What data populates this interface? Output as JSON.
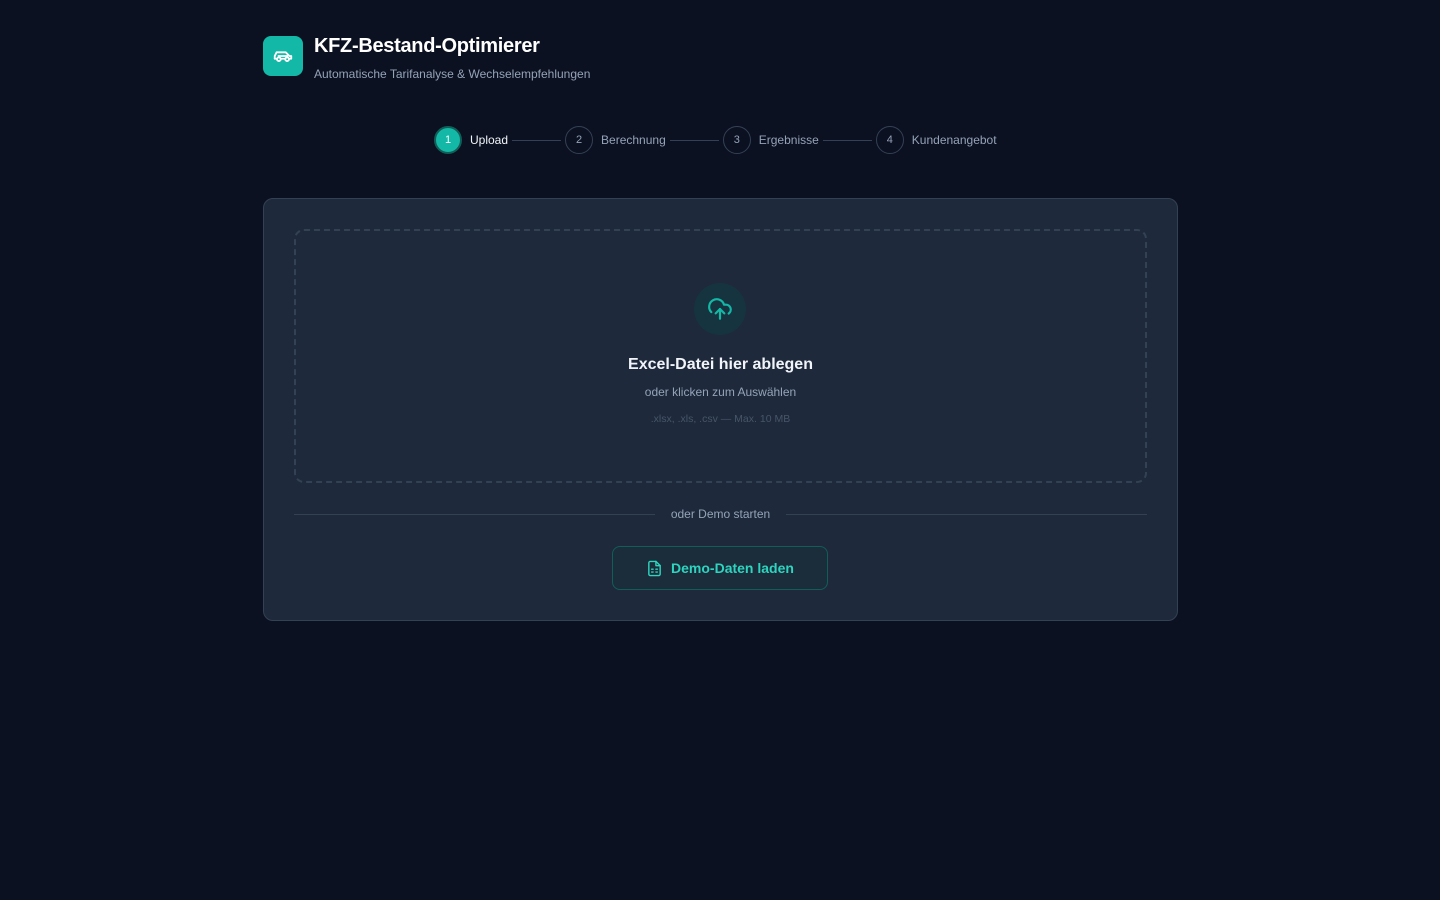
{
  "app": {
    "title": "KFZ-Bestand-Optimierer",
    "subtitle": "Automatische Tarifanalyse & Wechselempfehlungen",
    "logo_icon": "car-icon"
  },
  "steps": [
    {
      "number": "1",
      "label": "Upload",
      "active": true
    },
    {
      "number": "2",
      "label": "Berechnung",
      "active": false
    },
    {
      "number": "3",
      "label": "Ergebnisse",
      "active": false
    },
    {
      "number": "4",
      "label": "Kundenangebot",
      "active": false
    }
  ],
  "upload": {
    "icon": "cloud-upload-icon",
    "title": "Excel-Datei hier ablegen",
    "subtitle": "oder klicken zum Auswählen",
    "hint": ".xlsx, .xls, .csv — Max. 10 MB"
  },
  "divider_text": "oder Demo starten",
  "demo_button": {
    "icon": "spreadsheet-file-icon",
    "label": "Demo-Daten laden"
  },
  "colors": {
    "background": "#0b1120",
    "card": "#1e293b",
    "accent": "#14b8a6",
    "accent_text": "#2dd4bf",
    "muted_text": "#94a3b8",
    "border": "#334155"
  }
}
